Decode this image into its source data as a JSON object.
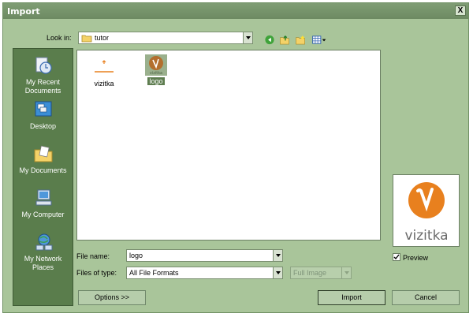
{
  "dialog": {
    "title": "Import",
    "close_glyph": "X"
  },
  "lookin": {
    "label": "Look in:",
    "value": "tutor",
    "icon": "folder-icon"
  },
  "toolbar": {
    "icons": [
      "back-icon",
      "up-folder-icon",
      "new-folder-icon",
      "view-menu-icon"
    ]
  },
  "places": [
    {
      "label_lines": [
        "My Recent",
        "Documents"
      ],
      "icon": "recent-documents-icon"
    },
    {
      "label_lines": [
        "Desktop"
      ],
      "icon": "desktop-icon"
    },
    {
      "label_lines": [
        "My Documents"
      ],
      "icon": "my-documents-icon"
    },
    {
      "label_lines": [
        "My Computer"
      ],
      "icon": "my-computer-icon"
    },
    {
      "label_lines": [
        "My Network",
        "Places"
      ],
      "icon": "network-places-icon"
    }
  ],
  "files": [
    {
      "name": "vizitka",
      "selected": false
    },
    {
      "name": "logo",
      "selected": true,
      "thumb_text": "vizitka"
    }
  ],
  "filename": {
    "label": "File name:",
    "value": "logo"
  },
  "filetype": {
    "label": "Files of type:",
    "value": "All File Formats"
  },
  "image_mode": {
    "value": "Full Image"
  },
  "preview": {
    "text": "vizitka",
    "checkbox_label": "Preview",
    "checked": true
  },
  "buttons": {
    "options": "Options >>",
    "import": "Import",
    "cancel": "Cancel"
  },
  "colors": {
    "accent": "#e8801e",
    "selection": "#5e7d50",
    "panel": "#5a7d4c"
  }
}
